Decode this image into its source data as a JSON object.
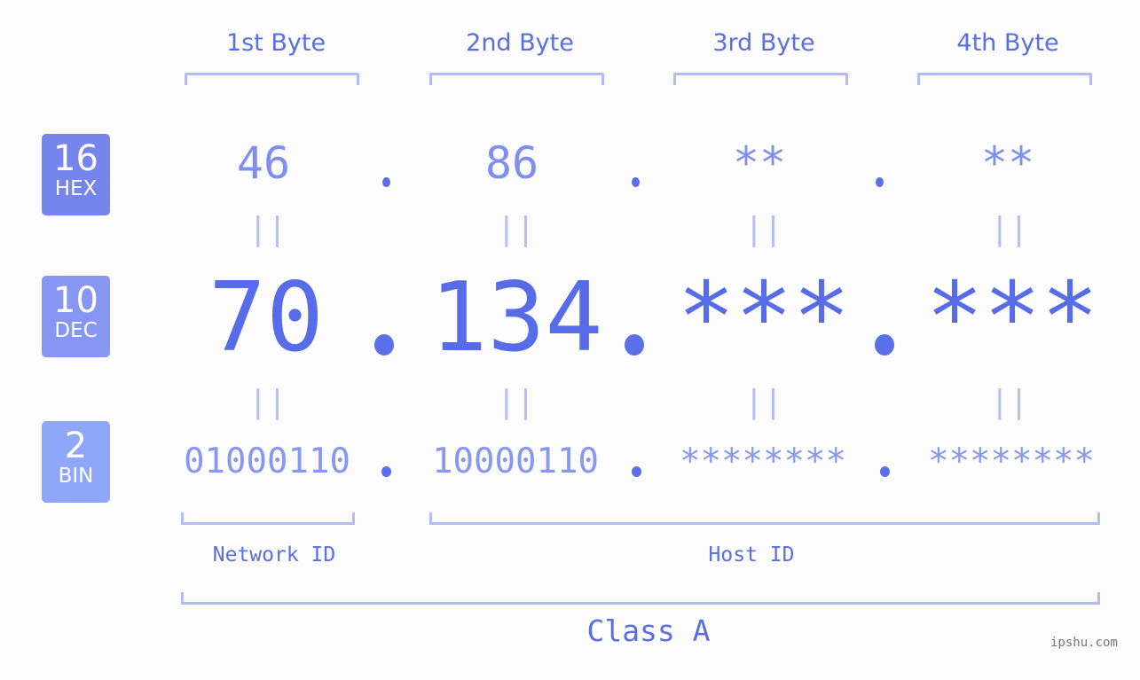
{
  "byte_headers": [
    "1st Byte",
    "2nd Byte",
    "3rd Byte",
    "4th Byte"
  ],
  "badges": [
    {
      "num": "16",
      "label": "HEX",
      "color": "#7685ec"
    },
    {
      "num": "10",
      "label": "DEC",
      "color": "#8696f2"
    },
    {
      "num": "2",
      "label": "BIN",
      "color": "#8fa7f8"
    }
  ],
  "hex": [
    "46",
    "86",
    "**",
    "**"
  ],
  "dec": [
    "70",
    "134",
    "***",
    "***"
  ],
  "bin": [
    "01000110",
    "10000110",
    "********",
    "********"
  ],
  "equals_sign": "||",
  "network_label": "Network ID",
  "host_label": "Host ID",
  "class_label": "Class A",
  "watermark": "ipshu.com"
}
